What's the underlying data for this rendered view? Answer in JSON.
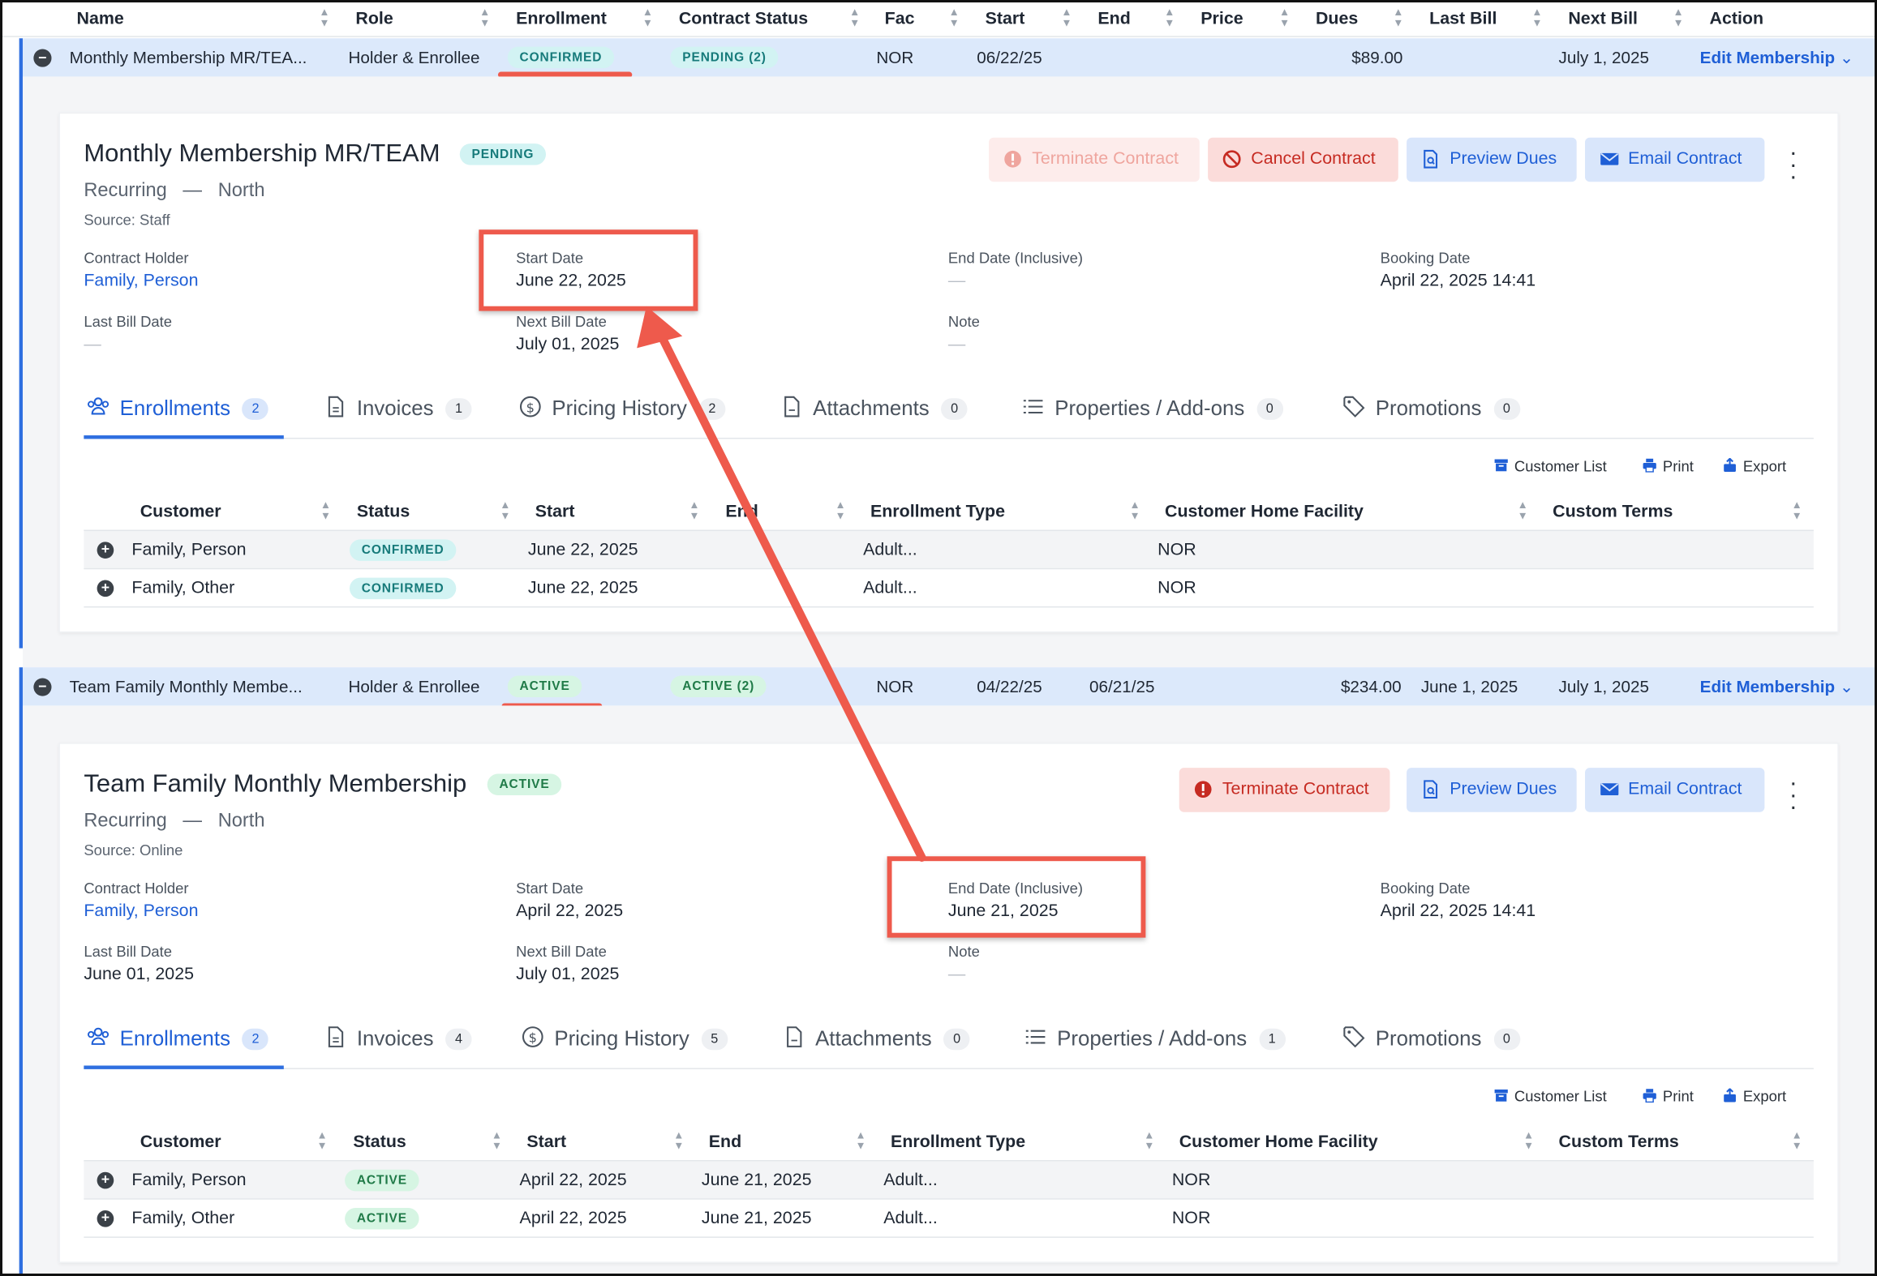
{
  "table_header": [
    "Name",
    "Role",
    "Enrollment",
    "Contract Status",
    "Fac",
    "Start",
    "End",
    "Price",
    "Dues",
    "Last Bill",
    "Next Bill",
    "Action"
  ],
  "summary_rows": [
    {
      "name": "Monthly Membership MR/TEA...",
      "role": "Holder & Enrollee",
      "enrollment": "CONFIRMED",
      "contract_status": "PENDING (2)",
      "fac": "NOR",
      "start": "06/22/25",
      "end": "",
      "price": "",
      "dues": "$89.00",
      "last_bill": "",
      "next_bill": "July 1, 2025",
      "action": "Edit Membership"
    },
    {
      "name": "Team Family Monthly Membe...",
      "role": "Holder & Enrollee",
      "enrollment": "ACTIVE",
      "contract_status": "ACTIVE (2)",
      "fac": "NOR",
      "start": "04/22/25",
      "end": "06/21/25",
      "price": "",
      "dues": "$234.00",
      "last_bill": "June 1, 2025",
      "next_bill": "July 1, 2025",
      "action": "Edit Membership"
    }
  ],
  "panels": [
    {
      "title": "Monthly Membership MR/TEAM",
      "status": "PENDING",
      "recurring": "Recurring",
      "sep": "—",
      "facility": "North",
      "source": "Source: Staff",
      "buttons": {
        "terminate": "Terminate Contract",
        "cancel": "Cancel Contract",
        "preview": "Preview Dues",
        "email": "Email Contract"
      },
      "fields": {
        "contract_holder_label": "Contract Holder",
        "contract_holder": "Family, Person",
        "start_label": "Start Date",
        "start": "June 22, 2025",
        "end_label": "End Date (Inclusive)",
        "end": "—",
        "booking_label": "Booking Date",
        "booking": "April 22, 2025 14:41",
        "last_bill_label": "Last Bill Date",
        "last_bill": "—",
        "next_bill_label": "Next Bill Date",
        "next_bill": "July 01, 2025",
        "note_label": "Note",
        "note": "—"
      },
      "tabs": [
        {
          "label": "Enrollments",
          "count": "2"
        },
        {
          "label": "Invoices",
          "count": "1"
        },
        {
          "label": "Pricing History",
          "count": "2"
        },
        {
          "label": "Attachments",
          "count": "0"
        },
        {
          "label": "Properties / Add-ons",
          "count": "0"
        },
        {
          "label": "Promotions",
          "count": "0"
        }
      ],
      "tools": {
        "customer_list": "Customer List",
        "print": "Print",
        "export": "Export"
      },
      "grid_headers": [
        "Customer",
        "Status",
        "Start",
        "End",
        "Enrollment Type",
        "Customer Home Facility",
        "Custom Terms"
      ],
      "rows": [
        {
          "customer": "Family, Person",
          "status": "CONFIRMED",
          "start": "June 22, 2025",
          "end": "",
          "type": "Adult...",
          "facility": "NOR",
          "terms": ""
        },
        {
          "customer": "Family, Other",
          "status": "CONFIRMED",
          "start": "June 22, 2025",
          "end": "",
          "type": "Adult...",
          "facility": "NOR",
          "terms": ""
        }
      ]
    },
    {
      "title": "Team Family Monthly Membership",
      "status": "ACTIVE",
      "recurring": "Recurring",
      "sep": "—",
      "facility": "North",
      "source": "Source: Online",
      "buttons": {
        "terminate": "Terminate Contract",
        "preview": "Preview Dues",
        "email": "Email Contract"
      },
      "fields": {
        "contract_holder_label": "Contract Holder",
        "contract_holder": "Family, Person",
        "start_label": "Start Date",
        "start": "April 22, 2025",
        "end_label": "End Date (Inclusive)",
        "end": "June 21, 2025",
        "booking_label": "Booking Date",
        "booking": "April 22, 2025 14:41",
        "last_bill_label": "Last Bill Date",
        "last_bill": "June 01, 2025",
        "next_bill_label": "Next Bill Date",
        "next_bill": "July 01, 2025",
        "note_label": "Note",
        "note": "—"
      },
      "tabs": [
        {
          "label": "Enrollments",
          "count": "2"
        },
        {
          "label": "Invoices",
          "count": "4"
        },
        {
          "label": "Pricing History",
          "count": "5"
        },
        {
          "label": "Attachments",
          "count": "0"
        },
        {
          "label": "Properties / Add-ons",
          "count": "1"
        },
        {
          "label": "Promotions",
          "count": "0"
        }
      ],
      "tools": {
        "customer_list": "Customer List",
        "print": "Print",
        "export": "Export"
      },
      "grid_headers": [
        "Customer",
        "Status",
        "Start",
        "End",
        "Enrollment Type",
        "Customer Home Facility",
        "Custom Terms"
      ],
      "rows": [
        {
          "customer": "Family, Person",
          "status": "ACTIVE",
          "start": "April 22, 2025",
          "end": "June 21, 2025",
          "type": "Adult...",
          "facility": "NOR",
          "terms": ""
        },
        {
          "customer": "Family, Other",
          "status": "ACTIVE",
          "start": "April 22, 2025",
          "end": "June 21, 2025",
          "type": "Adult...",
          "facility": "NOR",
          "terms": ""
        }
      ]
    }
  ],
  "colors": {
    "accent": "#1f5fd6",
    "annotation": "#ee5a4c",
    "row_highlight": "#dce9fb"
  },
  "icons": [
    "minus-circle-icon",
    "plus-circle-icon",
    "sort-icon",
    "chevron-down-icon",
    "alert-circle-icon",
    "ban-icon",
    "document-search-icon",
    "envelope-icon",
    "kebab-icon",
    "users-icon",
    "file-icon",
    "dollar-circle-icon",
    "paperclip-file-icon",
    "list-icon",
    "tag-icon",
    "archive-icon",
    "printer-icon",
    "export-icon"
  ]
}
